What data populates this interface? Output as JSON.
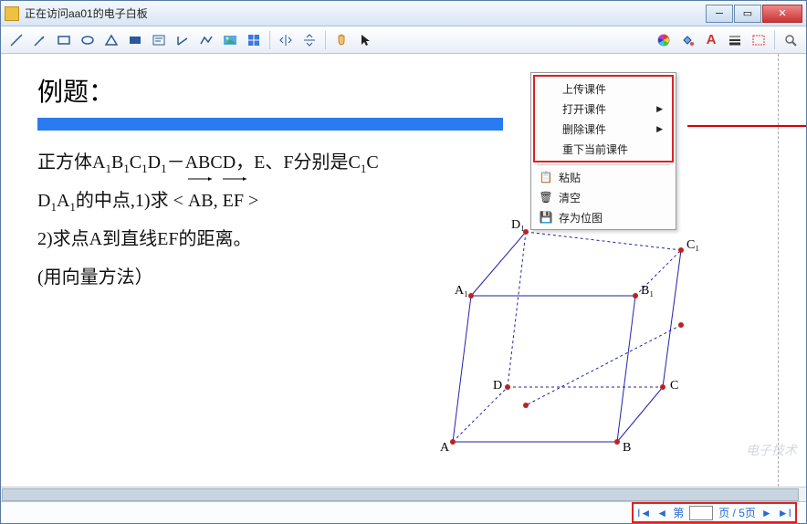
{
  "titlebar": {
    "text": "正在访问aa01的电子白板"
  },
  "toolbar": {
    "tools": [
      "line",
      "arrow",
      "rect",
      "ellipse",
      "triangle",
      "filled-rect",
      "text-box",
      "angle",
      "polyline",
      "image",
      "grid",
      "axis-h",
      "axis-v",
      "hand",
      "pointer"
    ],
    "right": [
      "color-wheel",
      "paint",
      "font-A",
      "line-weight",
      "dashed-box",
      "zoom"
    ]
  },
  "content": {
    "heading": "例题：",
    "line1_a": "正方体A",
    "line1_b": "B",
    "line1_c": "C",
    "line1_d": "D",
    "line1_mid": "－ABCD，E、F分别是C",
    "line1_end": "C",
    "line2_a": "D",
    "line2_b": "A",
    "line2_mid": "的中点,1)求 < ",
    "vec1": "AB",
    "vec_sep": ", ",
    "vec2": "EF",
    "line2_end": " >",
    "line3": "2)求点A到直线EF的距离。",
    "line4": "(用向量方法）",
    "sub1": "1"
  },
  "context_menu": {
    "upload": "上传课件",
    "open": "打开课件",
    "delete": "删除课件",
    "reset": "重下当前课件",
    "paste": "粘贴",
    "clear": "清空",
    "save_as": "存为位图"
  },
  "cube": {
    "labels": {
      "A1": "A₁",
      "B1": "B₁",
      "C1": "C₁",
      "D1": "D₁",
      "A": "A",
      "B": "B",
      "C": "C",
      "D": "D"
    }
  },
  "pager": {
    "prefix": "第",
    "current": "",
    "total_suffix": "页 / 5页"
  },
  "watermark": "电子技术"
}
